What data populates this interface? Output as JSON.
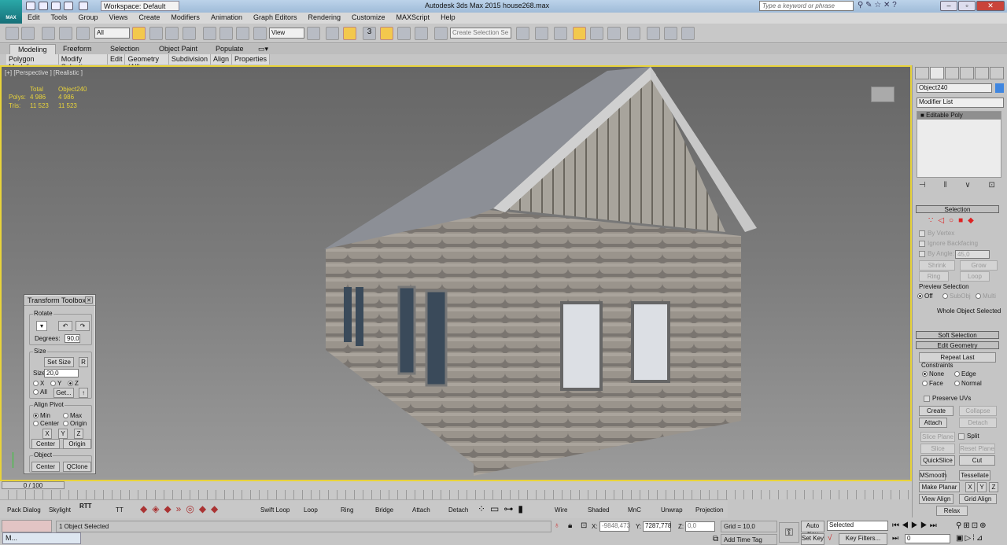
{
  "app": {
    "title": "Autodesk 3ds Max  2015     house268.max",
    "logo": "MAX",
    "workspace": "Workspace: Default",
    "search_placeholder": "Type a keyword or phrase"
  },
  "menu": [
    "Edit",
    "Tools",
    "Group",
    "Views",
    "Create",
    "Modifiers",
    "Animation",
    "Graph Editors",
    "Rendering",
    "Customize",
    "MAXScript",
    "Help"
  ],
  "toolbar": {
    "selection_filter": "All",
    "ref_coord": "View",
    "named_selection": "Create Selection Se",
    "snap_label": "3"
  },
  "ribbon": {
    "tabs": [
      "Modeling",
      "Freeform",
      "Selection",
      "Object Paint",
      "Populate"
    ],
    "active_tab": "Modeling",
    "panels": [
      "Polygon Modeling",
      "Modify Selection",
      "Edit",
      "Geometry (All)",
      "Subdivision",
      "Align",
      "Properties"
    ]
  },
  "viewport": {
    "label": "[+] [Perspective ] [Realistic ]",
    "stats": {
      "col_total": "Total",
      "col_object": "Object240",
      "polys_label": "Polys:",
      "polys_total": "4 986",
      "polys_object": "4 986",
      "tris_label": "Tris:",
      "tris_total": "11 523",
      "tris_object": "11 523"
    },
    "border_color": "#e8d33a"
  },
  "transform_toolbox": {
    "title": "Transform Toolbox",
    "rotate": "Rotate",
    "degrees_label": "Degrees:",
    "degrees": "90,0",
    "size": "Size",
    "set_size": "Set Size",
    "r": "R",
    "size_label": "Size",
    "size_value": "20,0",
    "x": "X",
    "y": "Y",
    "z": "Z",
    "all": "All",
    "get": "Get...",
    "align_pivot": "Align Pivot",
    "min": "Min",
    "max": "Max",
    "center": "Center",
    "origin": "Origin",
    "object": "Object",
    "qclone": "QClone"
  },
  "command_panel": {
    "object_name": "Object240",
    "object_color": "#3f86e0",
    "modifier_list": "Modifier List",
    "stack": [
      "Editable Poly"
    ],
    "selection": {
      "title": "Selection",
      "by_vertex": "By Vertex",
      "ignore_backfacing": "Ignore Backfacing",
      "by_angle": "By Angle:",
      "angle": "45,0",
      "shrink": "Shrink",
      "grow": "Grow",
      "ring": "Ring",
      "loop": "Loop",
      "preview": "Preview Selection",
      "off": "Off",
      "subobj": "SubObj",
      "multi": "Multi",
      "status": "Whole Object Selected"
    },
    "soft_selection": "Soft Selection",
    "edit_geometry": {
      "title": "Edit Geometry",
      "repeat_last": "Repeat Last",
      "constraints": "Constraints",
      "none": "None",
      "edge": "Edge",
      "face": "Face",
      "normal": "Normal",
      "preserve_uvs": "Preserve UVs",
      "create": "Create",
      "collapse": "Collapse",
      "attach": "Attach",
      "detach": "Detach",
      "slice_plane": "Slice Plane",
      "split": "Split",
      "slice": "Slice",
      "reset_plane": "Reset Plane",
      "quickslice": "QuickSlice",
      "cut": "Cut",
      "msmooth": "MSmooth",
      "tessellate": "Tessellate",
      "make_planar": "Make Planar",
      "x": "X",
      "y": "Y",
      "z": "Z",
      "view_align": "View Align",
      "grid_align": "Grid Align",
      "relax": "Relax"
    }
  },
  "timeline": {
    "frame": "0 / 100"
  },
  "bottom_ribbon": [
    "Pack Dialog",
    "Skylight",
    "RTT",
    "TT",
    "Swift Loop",
    "Loop",
    "Ring",
    "Bridge",
    "Attach",
    "Detach",
    "Wire",
    "Shaded",
    "MnC",
    "Unwrap",
    "Projection"
  ],
  "status": {
    "message": "1 Object Selected",
    "x_label": "X:",
    "x": "-9848,473",
    "y_label": "Y:",
    "y": "7287,778",
    "z_label": "Z:",
    "z": "0,0",
    "grid": "Grid = 10,0",
    "add_time_tag": "Add Time Tag",
    "auto_key": "Auto Key",
    "set_key": "Set Key",
    "key_mode": "Selected",
    "key_filters": "Key Filters...",
    "current_frame": "0",
    "taskbar": "M..."
  }
}
